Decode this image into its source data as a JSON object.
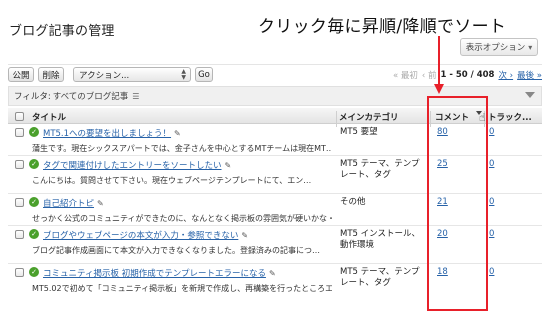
{
  "page": {
    "title": "ブログ記事の管理",
    "display_options": "表示オプション"
  },
  "annotation": {
    "text": "クリック毎に昇順/降順でソート",
    "color": "#e8202a"
  },
  "toolbar": {
    "publish_label": "公開",
    "delete_label": "削除",
    "action_select_value": "アクション...",
    "go_label": "Go"
  },
  "pagination": {
    "first": "« 最初",
    "prev": "‹ 前",
    "range": "1 - 50 / 408",
    "next": "次 ›",
    "last": "最後 »"
  },
  "filter": {
    "label": "フィルタ:",
    "value": "すべてのブログ記事"
  },
  "table": {
    "columns": {
      "title": "タイトル",
      "category": "メインカテゴリ",
      "comments": "コメント",
      "trackbacks": "トラック..."
    },
    "rows": [
      {
        "title": "MT5.1への要望を出しましょう！",
        "excerpt": "蒲生です。現在シックスアパートでは、金子さんを中心とするMTチームは現在MT…",
        "category": "MT5 要望",
        "comments": "80",
        "trackbacks": "0"
      },
      {
        "title": "タグで関連付けしたエントリーをソートしたい",
        "excerpt": "こんにちは。質問させて下さい。現在ウェブページテンプレートにて、エン…",
        "category": "MT5 テーマ、テンプレート、タグ",
        "comments": "25",
        "trackbacks": "0"
      },
      {
        "title": "自己紹介トピ",
        "excerpt": "せっかく公式のコミュニティができたのに、なんとなく掲示板の雰囲気が硬いかな・・・",
        "category": "その他",
        "comments": "21",
        "trackbacks": "0"
      },
      {
        "title": "ブログやウェブページの本文が入力・参照できない",
        "excerpt": "ブログ記事作成画面にて本文が入力できなくなりました。登録済みの記事につ…",
        "category": "MT5 インストール、動作環境",
        "comments": "20",
        "trackbacks": "0"
      },
      {
        "title": "コミュニティ掲示板 初期作成でテンプレートエラーになる",
        "excerpt": "MT5.02で初めて「コミュニティ掲示板」を新規で作成し、再構築を行ったところエ…",
        "category": "MT5 テーマ、テンプレート、タグ",
        "comments": "18",
        "trackbacks": "0"
      }
    ]
  }
}
